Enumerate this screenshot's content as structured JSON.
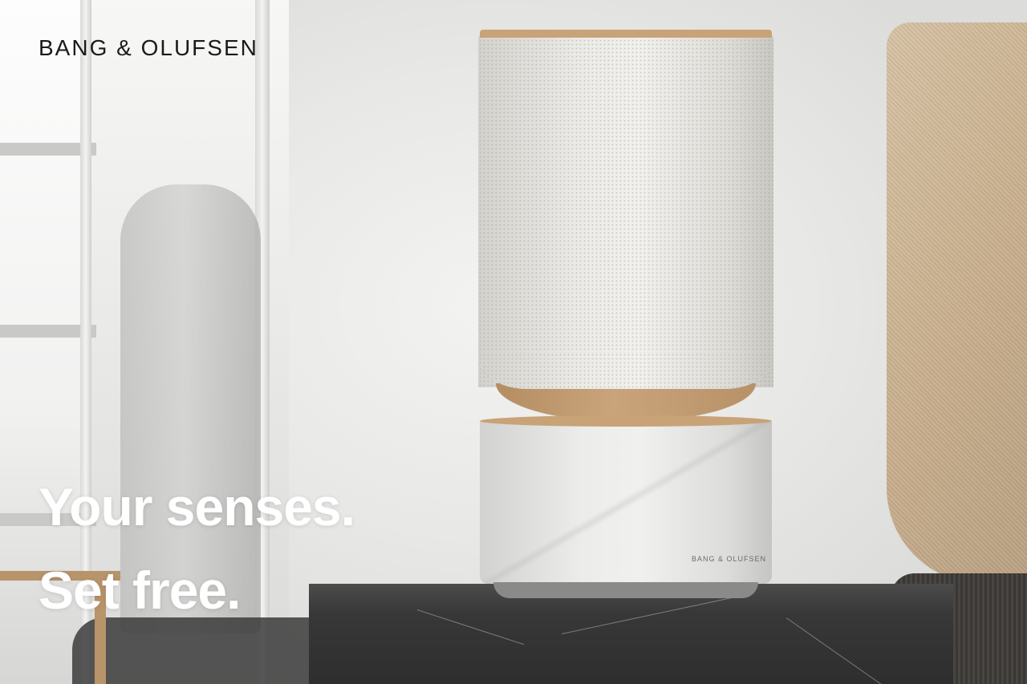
{
  "brand": {
    "logo_text": "BANG & OLUFSEN",
    "speaker_badge_text": "BANG & OLUFSEN"
  },
  "hero": {
    "headline_line1": "Your senses.",
    "headline_line2": "Set free."
  },
  "colors": {
    "headline_text": "#ffffff",
    "logo_text": "#1b1b1b",
    "speaker_wood_accent": "#c8a377",
    "pedestal_marble": "#3a3a3a"
  }
}
